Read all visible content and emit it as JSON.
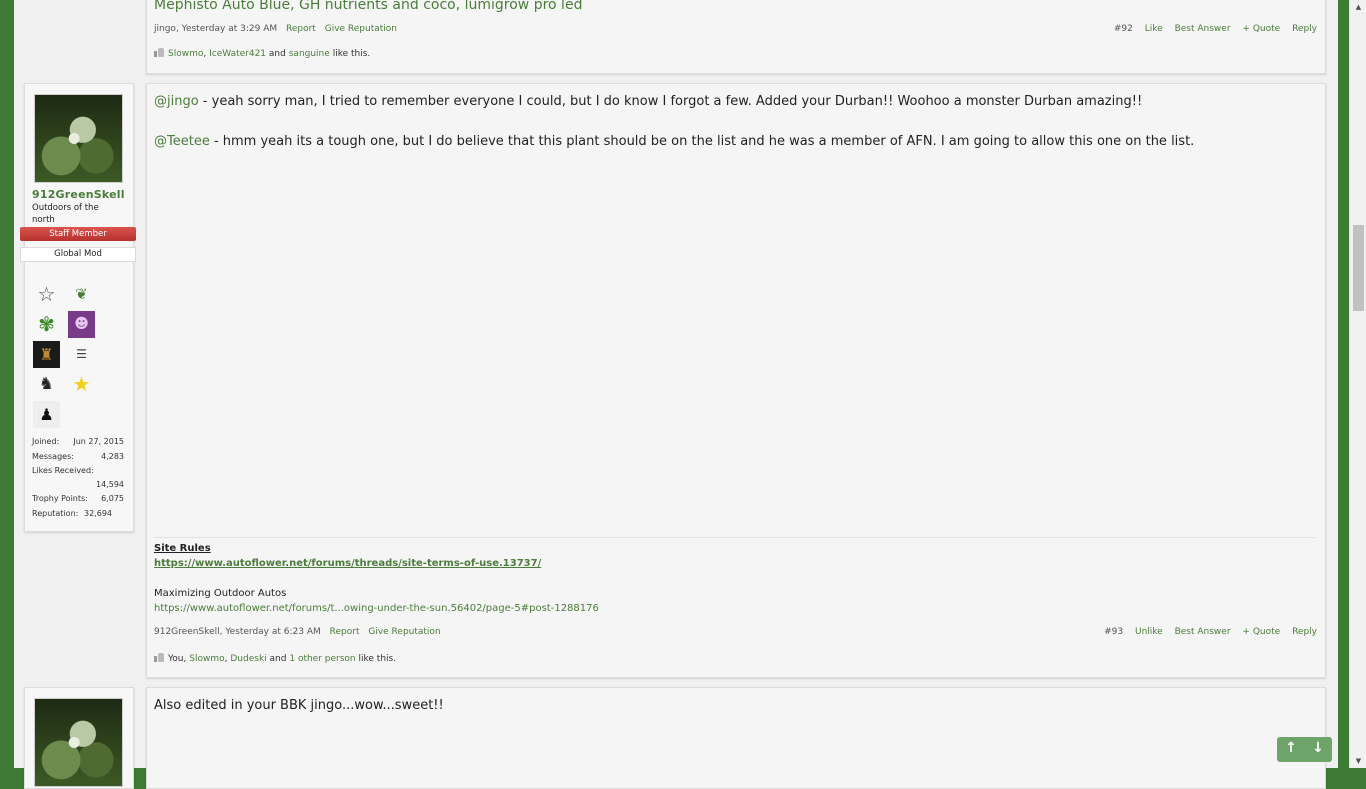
{
  "prev_post": {
    "title_text": "Mephisto Auto Blue, GH nutrients and coco, lumigrow pro led",
    "author": "jingo",
    "time": "Yesterday at 3:29 AM",
    "report": "Report",
    "give_rep": "Give Reputation",
    "number": "#92",
    "like": "Like",
    "best_answer": "Best Answer",
    "quote": "+ Quote",
    "reply": "Reply",
    "likes": {
      "a": "Slowmo",
      "b": "IceWater421",
      "c": "sanguine",
      "and": "and",
      "sep": ",",
      "tail": "like this."
    }
  },
  "post93": {
    "user": {
      "name": "912GreenSkell",
      "title": "Outdoors of the north",
      "staff": "Staff Member",
      "role": "Global Mod",
      "stats": {
        "joined_k": "Joined:",
        "joined_v": "Jun 27, 2015",
        "messages_k": "Messages:",
        "messages_v": "4,283",
        "likes_k": "Likes Received:",
        "likes_v": "14,594",
        "trophy_k": "Trophy Points:",
        "trophy_v": "6,075",
        "rep_k": "Reputation:",
        "rep_v": "32,694"
      }
    },
    "line1_mention": "@jingo",
    "line1_text": " - yeah sorry man, I tried to remember everyone I could, but I do know I forgot a few. Added your Durban!! Woohoo a monster Durban amazing!!",
    "line2_mention": "@Teetee",
    "line2_text": " - hmm yeah its a tough one, but I do believe that this plant should be on the list and he was a member of AFN. I am going to allow this one on the list.",
    "sig": {
      "rules_title": "Site Rules",
      "rules_link": "https://www.autoflower.net/forums/threads/site-terms-of-use.13737/",
      "outdoor_title": "Maximizing Outdoor Autos",
      "outdoor_link": "https://www.autoflower.net/forums/t...owing-under-the-sun.56402/page-5#post-1288176"
    },
    "author": "912GreenSkell",
    "time": "Yesterday at 6:23 AM",
    "report": "Report",
    "give_rep": "Give Reputation",
    "number": "#93",
    "unlike": "Unlike",
    "best_answer": "Best Answer",
    "quote": "+ Quote",
    "reply": "Reply",
    "likes": {
      "a": "You",
      "b": "Slowmo",
      "c": "Dudeski",
      "and": "and",
      "d": "1 other person",
      "sep": ",",
      "tail": "like this."
    }
  },
  "post94": {
    "text": "Also edited in your BBK jingo...wow...sweet!!"
  },
  "nav": {
    "up": "↑",
    "down": "↓"
  },
  "scroll": {
    "up": "▲",
    "down": "▼"
  }
}
